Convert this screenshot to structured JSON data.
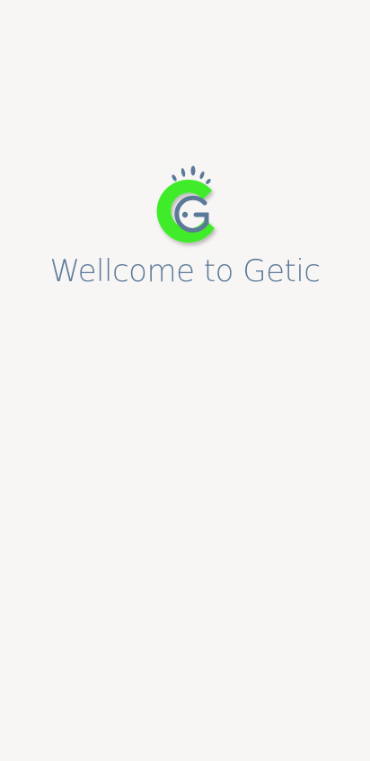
{
  "splash": {
    "logo_icon": "getic-g-logo-icon",
    "welcome_text": "Wellcome to Getic"
  },
  "colors": {
    "background": "#f7f6f5",
    "logo_green": "#3fec2a",
    "logo_blue": "#5c7a98",
    "text": "#5c7a98"
  }
}
